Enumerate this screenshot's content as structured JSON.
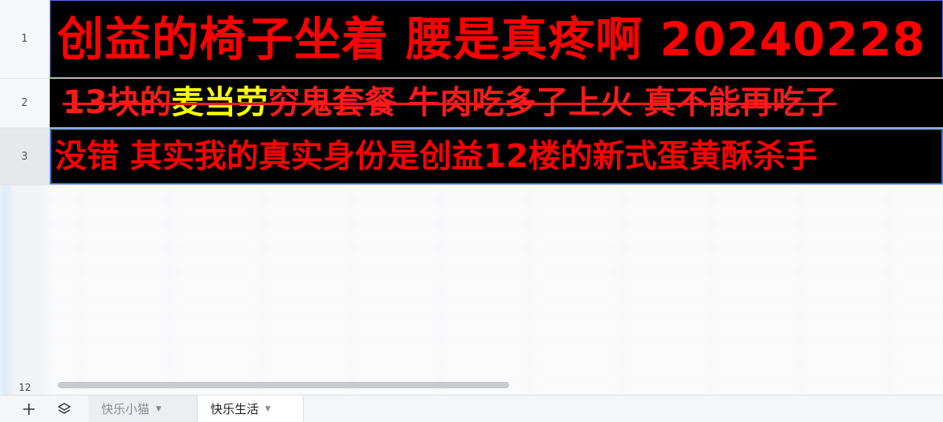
{
  "rows": [
    {
      "number": "1",
      "text": "创益的椅子坐着 腰是真疼啊  20240228"
    },
    {
      "number": "2",
      "prefix": "13块的",
      "highlight": "麦当劳",
      "rest": "穷鬼套餐 牛肉吃多了上火 真不能再吃了"
    },
    {
      "number": "3",
      "text": "没错 其实我的真实身份是创益12楼的新式蛋黄酥杀手"
    }
  ],
  "lower_row_number": "12",
  "tabs": [
    {
      "label": "快乐小猫",
      "active": false
    },
    {
      "label": "快乐生活",
      "active": true
    }
  ],
  "icons": {
    "add": "plus-icon",
    "sheets": "layers-icon",
    "dropdown": "caret-down-icon"
  },
  "colors": {
    "cell_bg": "#000000",
    "text_red": "#ff0000",
    "text_yellow": "#ffff00",
    "selection_border": "#4d6fd6"
  }
}
